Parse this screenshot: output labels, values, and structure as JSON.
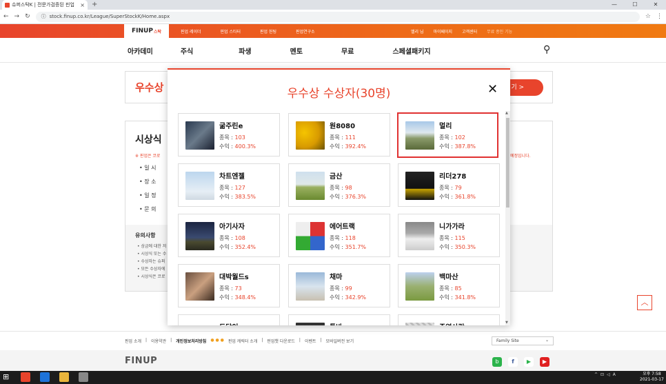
{
  "browser": {
    "tab_title": "슈퍼스탁K | 전문가검증된 핀업",
    "tab_close": "×",
    "new_tab": "+",
    "url": "stock.finup.co.kr/League/SuperStockK/Home.aspx",
    "win_min": "—",
    "win_max": "☐",
    "win_close": "✕"
  },
  "topbar": {
    "logo_main": "FINUP",
    "logo_accent": "스탁",
    "nav": [
      "핀업 레이더",
      "핀업 스타터",
      "핀업 헌팅",
      "핀업연구소"
    ],
    "user": "멜리 님",
    "mypage": "마이페이지",
    "support": "고객센터",
    "promo": "무료 종인 기능"
  },
  "mainnav": {
    "items": [
      "아카데미",
      "주식",
      "파생",
      "멘토",
      "무료",
      "스페셜패키지"
    ]
  },
  "background": {
    "banner_title": "우수상",
    "banner_btn": "기 >",
    "section_title": "시상식",
    "note_left": "※ 핀업은 코로",
    "note_right": "예정입니다.",
    "list": [
      "• 일   시",
      "• 장   소",
      "• 일   정",
      "• 문   의"
    ],
    "notice_title": "유의사항",
    "notice_lines": [
      "• 상금에 대한 저",
      "• 시상식 또는 수",
      "• 수상자는 슈퍼",
      "• 모든 수상자에",
      "• 시상식은 코로"
    ]
  },
  "scrolltop_label": "︿",
  "footer": {
    "links": [
      "핀업 소개",
      "이용약관",
      "개인정보처리방침",
      "핀업 캐릭터 소개",
      "핀업챗 다운로드",
      "이벤트",
      "모바일버전 보기"
    ],
    "family_site": "Family Site",
    "logo": "FINUP"
  },
  "taskbar": {
    "ampm": "오후 7:58",
    "date": "2021-03-17"
  },
  "modal": {
    "title": "우수상 수상자(30명)",
    "close": "✕",
    "label_count": "종목 : ",
    "label_return": "수익 : ",
    "winners": [
      {
        "name": "굶주린e",
        "count": "103",
        "return": "400.3%"
      },
      {
        "name": "원8080",
        "count": "111",
        "return": "392.4%"
      },
      {
        "name": "멀리",
        "count": "102",
        "return": "387.8%",
        "selected": true
      },
      {
        "name": "차트엔젤",
        "count": "127",
        "return": "383.5%"
      },
      {
        "name": "금산",
        "count": "98",
        "return": "376.3%"
      },
      {
        "name": "리더278",
        "count": "79",
        "return": "361.8%"
      },
      {
        "name": "아기사자",
        "count": "108",
        "return": "352.4%"
      },
      {
        "name": "에어트랙",
        "count": "118",
        "return": "351.7%"
      },
      {
        "name": "니가가라",
        "count": "115",
        "return": "350.3%"
      },
      {
        "name": "대박월드s",
        "count": "73",
        "return": "348.4%"
      },
      {
        "name": "채마",
        "count": "99",
        "return": "342.9%"
      },
      {
        "name": "백마산",
        "count": "85",
        "return": "341.8%"
      },
      {
        "name": "도담이",
        "count": "",
        "return": ""
      },
      {
        "name": "툴바",
        "count": "",
        "return": ""
      },
      {
        "name": "준영사랑",
        "count": "",
        "return": ""
      }
    ]
  },
  "colors": {
    "brand": "#e8442c",
    "selected_border": "#e03030"
  }
}
